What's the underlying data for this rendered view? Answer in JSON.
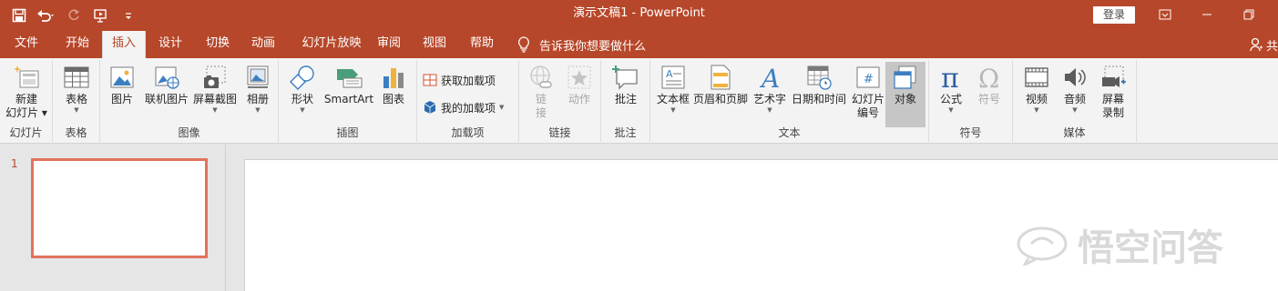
{
  "window": {
    "title": "演示文稿1  -  PowerPoint",
    "sign_in": "登录"
  },
  "tabs": [
    "文件",
    "开始",
    "插入",
    "设计",
    "切换",
    "动画",
    "幻灯片放映",
    "审阅",
    "视图",
    "帮助"
  ],
  "active_tab": "插入",
  "tell_me": "告诉我你想要做什么",
  "share_label": "共",
  "ribbon": {
    "slides": {
      "label": "幻灯片",
      "new_slide": [
        "新建",
        "幻灯片"
      ]
    },
    "tables": {
      "label": "表格",
      "table": "表格"
    },
    "images": {
      "label": "图像",
      "pictures": "图片",
      "online_pictures": "联机图片",
      "screenshot": "屏幕截图",
      "album": "相册"
    },
    "illustrations": {
      "label": "插图",
      "shapes": "形状",
      "smartart": "SmartArt",
      "chart": "图表"
    },
    "addins": {
      "label": "加载项",
      "get_addins": "获取加载项",
      "my_addins": "我的加载项"
    },
    "links": {
      "label": "链接",
      "link": [
        "链",
        "接"
      ],
      "action": "动作"
    },
    "comments": {
      "label": "批注",
      "comment": "批注"
    },
    "text": {
      "label": "文本",
      "textbox": "文本框",
      "header_footer": "页眉和页脚",
      "wordart": "艺术字",
      "datetime": "日期和时间",
      "slide_number": [
        "幻灯片",
        "编号"
      ],
      "object": "对象"
    },
    "symbols": {
      "label": "符号",
      "equation": "公式",
      "symbol": "符号"
    },
    "media": {
      "label": "媒体",
      "video": "视频",
      "audio": "音频",
      "screen_recording": [
        "屏幕",
        "录制"
      ]
    }
  },
  "slides_pane": {
    "slide_number": "1"
  },
  "watermark": "悟空问答",
  "colors": {
    "accent": "#b7472a",
    "thumb_border": "#e2725b",
    "ribbon_bg": "#f3f3f3"
  }
}
